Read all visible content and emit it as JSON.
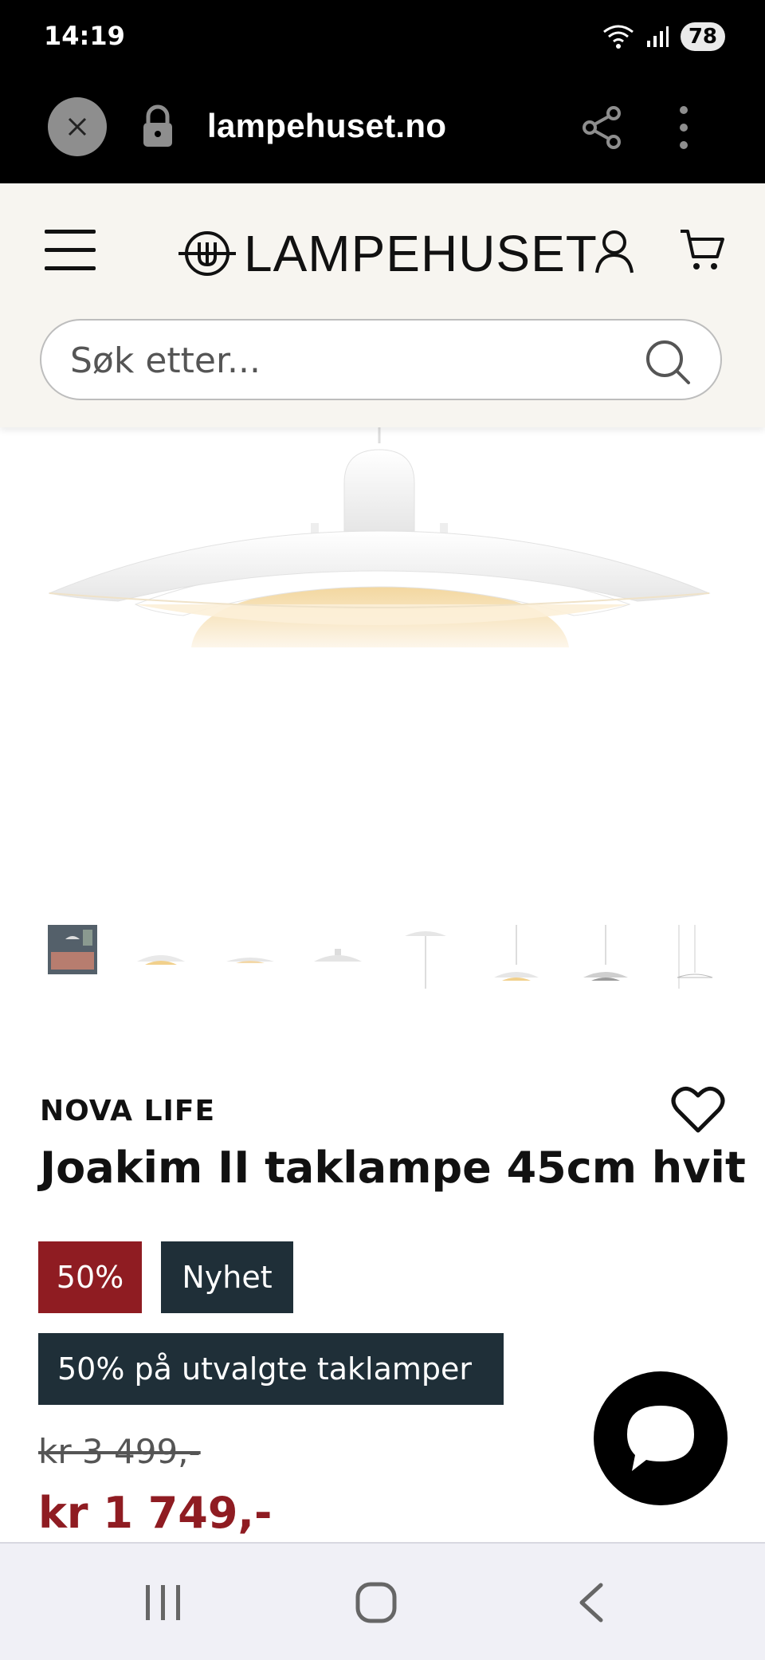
{
  "status_bar": {
    "time": "14:19",
    "battery": "78",
    "icons": [
      "wifi-icon",
      "signal-icon",
      "battery-icon"
    ]
  },
  "browser": {
    "url": "lampehuset.no",
    "icons": [
      "close-icon",
      "lock-icon",
      "share-icon",
      "more-icon"
    ]
  },
  "header": {
    "logo_text": "LAMPEHUSET",
    "icons": [
      "menu-icon",
      "logo-icon",
      "user-icon",
      "cart-icon"
    ]
  },
  "search": {
    "placeholder": "Søk etter..."
  },
  "product": {
    "brand": "NOVA LIFE",
    "title": "Joakim II taklampe 45cm hvit",
    "badges": {
      "sale": "50%",
      "new": "Nyhet",
      "campaign": "50% på utvalgte taklamper"
    },
    "old_price": "kr 3 499,-",
    "price": "kr 1 749,-",
    "thumbnail_count": 8
  },
  "colors": {
    "sale_red": "#8f1c22",
    "badge_dark": "#1f2f38",
    "header_bg": "#f7f5f0"
  }
}
